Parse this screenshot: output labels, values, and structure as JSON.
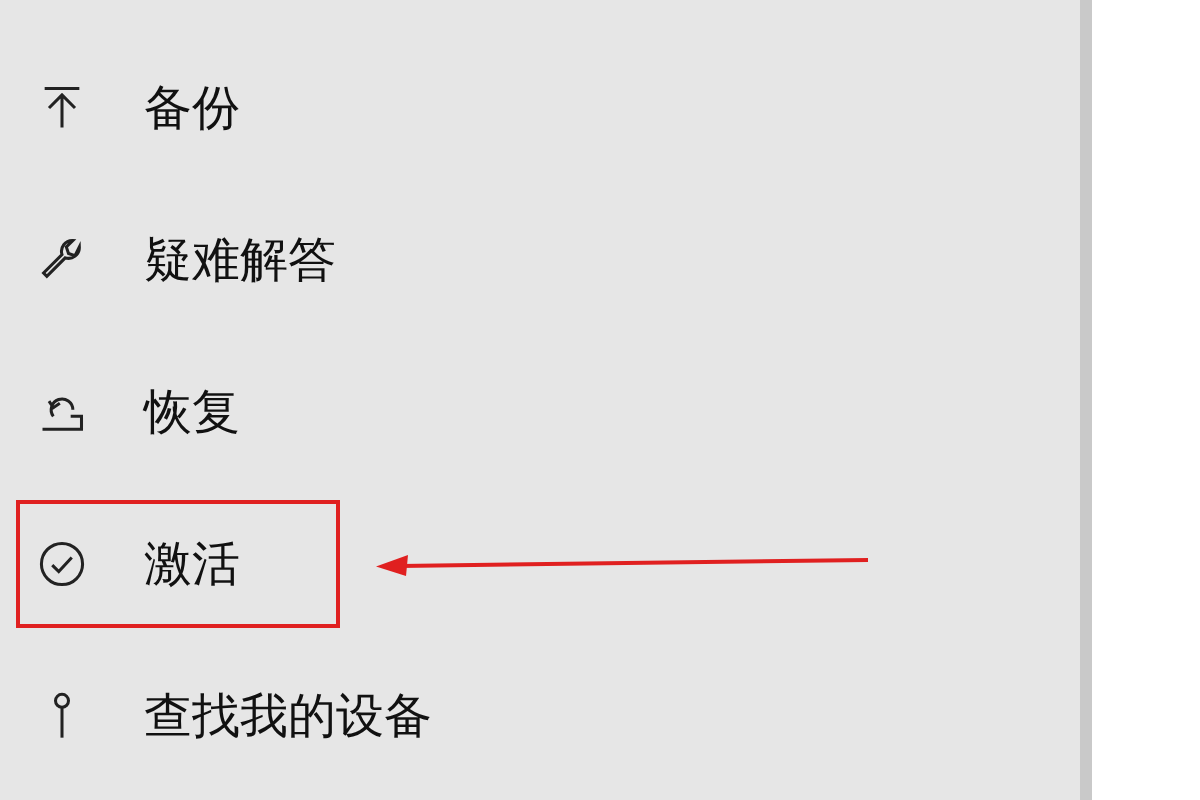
{
  "nav_items": [
    {
      "kind": "backup",
      "label": "备份",
      "annotated": false
    },
    {
      "kind": "troubleshoot",
      "label": "疑难解答",
      "annotated": false
    },
    {
      "kind": "recovery",
      "label": "恢复",
      "annotated": false
    },
    {
      "kind": "activation",
      "label": "激活",
      "annotated": true
    },
    {
      "kind": "find-device",
      "label": "查找我的设备",
      "annotated": false
    }
  ]
}
